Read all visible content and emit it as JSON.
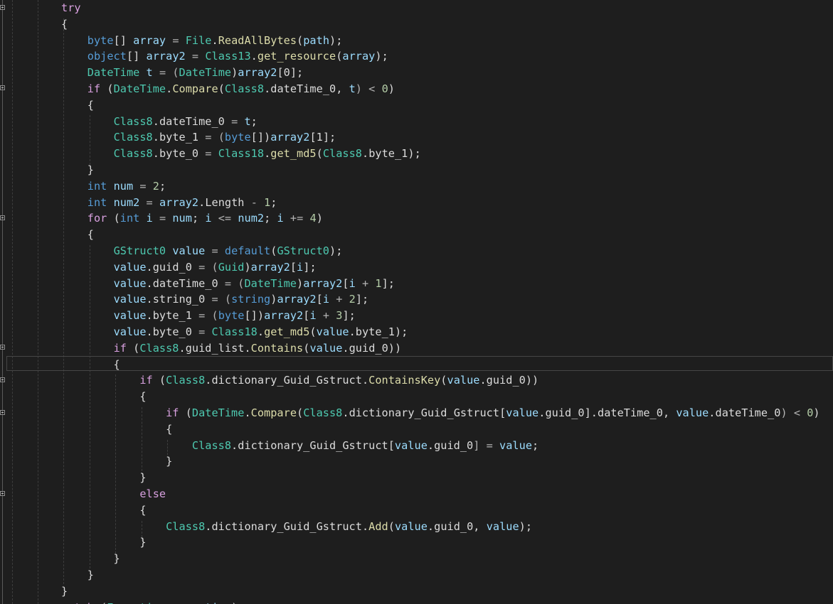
{
  "editor": {
    "lines": [
      [
        {
          "t": "try",
          "c": "ctl"
        }
      ],
      [
        {
          "t": "{",
          "c": "tk"
        }
      ],
      [
        {
          "t": "    ",
          "c": "tk"
        },
        {
          "t": "byte",
          "c": "kw"
        },
        {
          "t": "[] ",
          "c": "tk"
        },
        {
          "t": "array",
          "c": "vr"
        },
        {
          "t": " = ",
          "c": "op"
        },
        {
          "t": "File",
          "c": "ty"
        },
        {
          "t": ".",
          "c": "tk"
        },
        {
          "t": "ReadAllBytes",
          "c": "fn"
        },
        {
          "t": "(",
          "c": "tk"
        },
        {
          "t": "path",
          "c": "vr"
        },
        {
          "t": ");",
          "c": "tk"
        }
      ],
      [
        {
          "t": "    ",
          "c": "tk"
        },
        {
          "t": "object",
          "c": "kw"
        },
        {
          "t": "[] ",
          "c": "tk"
        },
        {
          "t": "array2",
          "c": "vr"
        },
        {
          "t": " = ",
          "c": "op"
        },
        {
          "t": "Class13",
          "c": "ty"
        },
        {
          "t": ".",
          "c": "tk"
        },
        {
          "t": "get_resource",
          "c": "fn"
        },
        {
          "t": "(",
          "c": "tk"
        },
        {
          "t": "array",
          "c": "vr"
        },
        {
          "t": ");",
          "c": "tk"
        }
      ],
      [
        {
          "t": "    ",
          "c": "tk"
        },
        {
          "t": "DateTime",
          "c": "ty"
        },
        {
          "t": " ",
          "c": "tk"
        },
        {
          "t": "t",
          "c": "vr"
        },
        {
          "t": " = (",
          "c": "op"
        },
        {
          "t": "DateTime",
          "c": "ty"
        },
        {
          "t": ")",
          "c": "tk"
        },
        {
          "t": "array2",
          "c": "vr"
        },
        {
          "t": "[0];",
          "c": "tk"
        }
      ],
      [
        {
          "t": "    ",
          "c": "tk"
        },
        {
          "t": "if",
          "c": "ctl"
        },
        {
          "t": " (",
          "c": "tk"
        },
        {
          "t": "DateTime",
          "c": "ty"
        },
        {
          "t": ".",
          "c": "tk"
        },
        {
          "t": "Compare",
          "c": "fn"
        },
        {
          "t": "(",
          "c": "tk"
        },
        {
          "t": "Class8",
          "c": "ty"
        },
        {
          "t": ".",
          "c": "tk"
        },
        {
          "t": "dateTime_0",
          "c": "fd"
        },
        {
          "t": ", ",
          "c": "tk"
        },
        {
          "t": "t",
          "c": "vr"
        },
        {
          "t": ") < ",
          "c": "op"
        },
        {
          "t": "0",
          "c": "nm"
        },
        {
          "t": ")",
          "c": "tk"
        }
      ],
      [
        {
          "t": "    {",
          "c": "tk"
        }
      ],
      [
        {
          "t": "        ",
          "c": "tk"
        },
        {
          "t": "Class8",
          "c": "ty"
        },
        {
          "t": ".",
          "c": "tk"
        },
        {
          "t": "dateTime_0",
          "c": "fd"
        },
        {
          "t": " = ",
          "c": "op"
        },
        {
          "t": "t",
          "c": "vr"
        },
        {
          "t": ";",
          "c": "tk"
        }
      ],
      [
        {
          "t": "        ",
          "c": "tk"
        },
        {
          "t": "Class8",
          "c": "ty"
        },
        {
          "t": ".",
          "c": "tk"
        },
        {
          "t": "byte_1",
          "c": "fd"
        },
        {
          "t": " = (",
          "c": "op"
        },
        {
          "t": "byte",
          "c": "kw"
        },
        {
          "t": "[])",
          "c": "tk"
        },
        {
          "t": "array2",
          "c": "vr"
        },
        {
          "t": "[1];",
          "c": "tk"
        }
      ],
      [
        {
          "t": "        ",
          "c": "tk"
        },
        {
          "t": "Class8",
          "c": "ty"
        },
        {
          "t": ".",
          "c": "tk"
        },
        {
          "t": "byte_0",
          "c": "fd"
        },
        {
          "t": " = ",
          "c": "op"
        },
        {
          "t": "Class18",
          "c": "ty"
        },
        {
          "t": ".",
          "c": "tk"
        },
        {
          "t": "get_md5",
          "c": "fn"
        },
        {
          "t": "(",
          "c": "tk"
        },
        {
          "t": "Class8",
          "c": "ty"
        },
        {
          "t": ".",
          "c": "tk"
        },
        {
          "t": "byte_1",
          "c": "fd"
        },
        {
          "t": ");",
          "c": "tk"
        }
      ],
      [
        {
          "t": "    }",
          "c": "tk"
        }
      ],
      [
        {
          "t": "    ",
          "c": "tk"
        },
        {
          "t": "int",
          "c": "kw"
        },
        {
          "t": " ",
          "c": "tk"
        },
        {
          "t": "num",
          "c": "vr"
        },
        {
          "t": " = ",
          "c": "op"
        },
        {
          "t": "2",
          "c": "nm"
        },
        {
          "t": ";",
          "c": "tk"
        }
      ],
      [
        {
          "t": "    ",
          "c": "tk"
        },
        {
          "t": "int",
          "c": "kw"
        },
        {
          "t": " ",
          "c": "tk"
        },
        {
          "t": "num2",
          "c": "vr"
        },
        {
          "t": " = ",
          "c": "op"
        },
        {
          "t": "array2",
          "c": "vr"
        },
        {
          "t": ".",
          "c": "tk"
        },
        {
          "t": "Length",
          "c": "fd"
        },
        {
          "t": " - ",
          "c": "op"
        },
        {
          "t": "1",
          "c": "nm"
        },
        {
          "t": ";",
          "c": "tk"
        }
      ],
      [
        {
          "t": "    ",
          "c": "tk"
        },
        {
          "t": "for",
          "c": "ctl"
        },
        {
          "t": " (",
          "c": "tk"
        },
        {
          "t": "int",
          "c": "kw"
        },
        {
          "t": " ",
          "c": "tk"
        },
        {
          "t": "i",
          "c": "vr"
        },
        {
          "t": " = ",
          "c": "op"
        },
        {
          "t": "num",
          "c": "vr"
        },
        {
          "t": "; ",
          "c": "tk"
        },
        {
          "t": "i",
          "c": "vr"
        },
        {
          "t": " <= ",
          "c": "op"
        },
        {
          "t": "num2",
          "c": "vr"
        },
        {
          "t": "; ",
          "c": "tk"
        },
        {
          "t": "i",
          "c": "vr"
        },
        {
          "t": " += ",
          "c": "op"
        },
        {
          "t": "4",
          "c": "nm"
        },
        {
          "t": ")",
          "c": "tk"
        }
      ],
      [
        {
          "t": "    {",
          "c": "tk"
        }
      ],
      [
        {
          "t": "        ",
          "c": "tk"
        },
        {
          "t": "GStruct0",
          "c": "ty"
        },
        {
          "t": " ",
          "c": "tk"
        },
        {
          "t": "value",
          "c": "vr"
        },
        {
          "t": " = ",
          "c": "op"
        },
        {
          "t": "default",
          "c": "kw"
        },
        {
          "t": "(",
          "c": "tk"
        },
        {
          "t": "GStruct0",
          "c": "ty"
        },
        {
          "t": ");",
          "c": "tk"
        }
      ],
      [
        {
          "t": "        ",
          "c": "tk"
        },
        {
          "t": "value",
          "c": "vr"
        },
        {
          "t": ".",
          "c": "tk"
        },
        {
          "t": "guid_0",
          "c": "fd"
        },
        {
          "t": " = (",
          "c": "op"
        },
        {
          "t": "Guid",
          "c": "ty"
        },
        {
          "t": ")",
          "c": "tk"
        },
        {
          "t": "array2",
          "c": "vr"
        },
        {
          "t": "[",
          "c": "tk"
        },
        {
          "t": "i",
          "c": "vr"
        },
        {
          "t": "];",
          "c": "tk"
        }
      ],
      [
        {
          "t": "        ",
          "c": "tk"
        },
        {
          "t": "value",
          "c": "vr"
        },
        {
          "t": ".",
          "c": "tk"
        },
        {
          "t": "dateTime_0",
          "c": "fd"
        },
        {
          "t": " = (",
          "c": "op"
        },
        {
          "t": "DateTime",
          "c": "ty"
        },
        {
          "t": ")",
          "c": "tk"
        },
        {
          "t": "array2",
          "c": "vr"
        },
        {
          "t": "[",
          "c": "tk"
        },
        {
          "t": "i",
          "c": "vr"
        },
        {
          "t": " + ",
          "c": "op"
        },
        {
          "t": "1",
          "c": "nm"
        },
        {
          "t": "];",
          "c": "tk"
        }
      ],
      [
        {
          "t": "        ",
          "c": "tk"
        },
        {
          "t": "value",
          "c": "vr"
        },
        {
          "t": ".",
          "c": "tk"
        },
        {
          "t": "string_0",
          "c": "fd"
        },
        {
          "t": " = (",
          "c": "op"
        },
        {
          "t": "string",
          "c": "kw"
        },
        {
          "t": ")",
          "c": "tk"
        },
        {
          "t": "array2",
          "c": "vr"
        },
        {
          "t": "[",
          "c": "tk"
        },
        {
          "t": "i",
          "c": "vr"
        },
        {
          "t": " + ",
          "c": "op"
        },
        {
          "t": "2",
          "c": "nm"
        },
        {
          "t": "];",
          "c": "tk"
        }
      ],
      [
        {
          "t": "        ",
          "c": "tk"
        },
        {
          "t": "value",
          "c": "vr"
        },
        {
          "t": ".",
          "c": "tk"
        },
        {
          "t": "byte_1",
          "c": "fd"
        },
        {
          "t": " = (",
          "c": "op"
        },
        {
          "t": "byte",
          "c": "kw"
        },
        {
          "t": "[])",
          "c": "tk"
        },
        {
          "t": "array2",
          "c": "vr"
        },
        {
          "t": "[",
          "c": "tk"
        },
        {
          "t": "i",
          "c": "vr"
        },
        {
          "t": " + ",
          "c": "op"
        },
        {
          "t": "3",
          "c": "nm"
        },
        {
          "t": "];",
          "c": "tk"
        }
      ],
      [
        {
          "t": "        ",
          "c": "tk"
        },
        {
          "t": "value",
          "c": "vr"
        },
        {
          "t": ".",
          "c": "tk"
        },
        {
          "t": "byte_0",
          "c": "fd"
        },
        {
          "t": " = ",
          "c": "op"
        },
        {
          "t": "Class18",
          "c": "ty"
        },
        {
          "t": ".",
          "c": "tk"
        },
        {
          "t": "get_md5",
          "c": "fn"
        },
        {
          "t": "(",
          "c": "tk"
        },
        {
          "t": "value",
          "c": "vr"
        },
        {
          "t": ".",
          "c": "tk"
        },
        {
          "t": "byte_1",
          "c": "fd"
        },
        {
          "t": ");",
          "c": "tk"
        }
      ],
      [
        {
          "t": "        ",
          "c": "tk"
        },
        {
          "t": "if",
          "c": "ctl"
        },
        {
          "t": " (",
          "c": "tk"
        },
        {
          "t": "Class8",
          "c": "ty"
        },
        {
          "t": ".",
          "c": "tk"
        },
        {
          "t": "guid_list",
          "c": "fd"
        },
        {
          "t": ".",
          "c": "tk"
        },
        {
          "t": "Contains",
          "c": "fn"
        },
        {
          "t": "(",
          "c": "tk"
        },
        {
          "t": "value",
          "c": "vr"
        },
        {
          "t": ".",
          "c": "tk"
        },
        {
          "t": "guid_0",
          "c": "fd"
        },
        {
          "t": "))",
          "c": "tk"
        }
      ],
      [
        {
          "t": "        {",
          "c": "tk"
        }
      ],
      [
        {
          "t": "            ",
          "c": "tk"
        },
        {
          "t": "if",
          "c": "ctl"
        },
        {
          "t": " (",
          "c": "tk"
        },
        {
          "t": "Class8",
          "c": "ty"
        },
        {
          "t": ".",
          "c": "tk"
        },
        {
          "t": "dictionary_Guid_Gstruct",
          "c": "fd"
        },
        {
          "t": ".",
          "c": "tk"
        },
        {
          "t": "ContainsKey",
          "c": "fn"
        },
        {
          "t": "(",
          "c": "tk"
        },
        {
          "t": "value",
          "c": "vr"
        },
        {
          "t": ".",
          "c": "tk"
        },
        {
          "t": "guid_0",
          "c": "fd"
        },
        {
          "t": "))",
          "c": "tk"
        }
      ],
      [
        {
          "t": "            {",
          "c": "tk"
        }
      ],
      [
        {
          "t": "                ",
          "c": "tk"
        },
        {
          "t": "if",
          "c": "ctl"
        },
        {
          "t": " (",
          "c": "tk"
        },
        {
          "t": "DateTime",
          "c": "ty"
        },
        {
          "t": ".",
          "c": "tk"
        },
        {
          "t": "Compare",
          "c": "fn"
        },
        {
          "t": "(",
          "c": "tk"
        },
        {
          "t": "Class8",
          "c": "ty"
        },
        {
          "t": ".",
          "c": "tk"
        },
        {
          "t": "dictionary_Guid_Gstruct",
          "c": "fd"
        },
        {
          "t": "[",
          "c": "tk"
        },
        {
          "t": "value",
          "c": "vr"
        },
        {
          "t": ".",
          "c": "tk"
        },
        {
          "t": "guid_0",
          "c": "fd"
        },
        {
          "t": "].",
          "c": "tk"
        },
        {
          "t": "dateTime_0",
          "c": "fd"
        },
        {
          "t": ", ",
          "c": "tk"
        },
        {
          "t": "value",
          "c": "vr"
        },
        {
          "t": ".",
          "c": "tk"
        },
        {
          "t": "dateTime_0",
          "c": "fd"
        },
        {
          "t": ") < ",
          "c": "op"
        },
        {
          "t": "0",
          "c": "nm"
        },
        {
          "t": ")",
          "c": "tk"
        }
      ],
      [
        {
          "t": "                {",
          "c": "tk"
        }
      ],
      [
        {
          "t": "                    ",
          "c": "tk"
        },
        {
          "t": "Class8",
          "c": "ty"
        },
        {
          "t": ".",
          "c": "tk"
        },
        {
          "t": "dictionary_Guid_Gstruct",
          "c": "fd"
        },
        {
          "t": "[",
          "c": "tk"
        },
        {
          "t": "value",
          "c": "vr"
        },
        {
          "t": ".",
          "c": "tk"
        },
        {
          "t": "guid_0",
          "c": "fd"
        },
        {
          "t": "] = ",
          "c": "op"
        },
        {
          "t": "value",
          "c": "vr"
        },
        {
          "t": ";",
          "c": "tk"
        }
      ],
      [
        {
          "t": "                }",
          "c": "tk"
        }
      ],
      [
        {
          "t": "            }",
          "c": "tk"
        }
      ],
      [
        {
          "t": "            ",
          "c": "tk"
        },
        {
          "t": "else",
          "c": "ctl"
        }
      ],
      [
        {
          "t": "            {",
          "c": "tk"
        }
      ],
      [
        {
          "t": "                ",
          "c": "tk"
        },
        {
          "t": "Class8",
          "c": "ty"
        },
        {
          "t": ".",
          "c": "tk"
        },
        {
          "t": "dictionary_Guid_Gstruct",
          "c": "fd"
        },
        {
          "t": ".",
          "c": "tk"
        },
        {
          "t": "Add",
          "c": "fn"
        },
        {
          "t": "(",
          "c": "tk"
        },
        {
          "t": "value",
          "c": "vr"
        },
        {
          "t": ".",
          "c": "tk"
        },
        {
          "t": "guid_0",
          "c": "fd"
        },
        {
          "t": ", ",
          "c": "tk"
        },
        {
          "t": "value",
          "c": "vr"
        },
        {
          "t": ");",
          "c": "tk"
        }
      ],
      [
        {
          "t": "            }",
          "c": "tk"
        }
      ],
      [
        {
          "t": "        }",
          "c": "tk"
        }
      ],
      [
        {
          "t": "    }",
          "c": "tk"
        }
      ],
      [
        {
          "t": "}",
          "c": "tk"
        }
      ],
      [
        {
          "t": "catch",
          "c": "ctl"
        },
        {
          "t": " (",
          "c": "tk"
        },
        {
          "t": "Exception",
          "c": "ty"
        },
        {
          "t": " ",
          "c": "tk"
        },
        {
          "t": "exception",
          "c": "vr"
        },
        {
          "t": ")",
          "c": "tk"
        }
      ]
    ],
    "fold_icons": [
      "collapse-icon"
    ]
  }
}
